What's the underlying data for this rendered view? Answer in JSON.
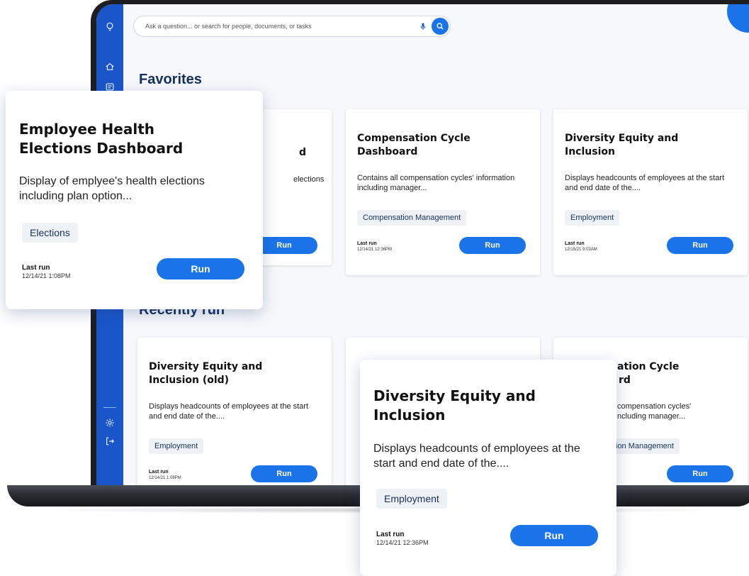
{
  "search": {
    "placeholder": "Ask a question... or search for people, documents, or tasks"
  },
  "sections": {
    "favorites": "Favorites",
    "recently_run": "Recently run"
  },
  "favorites": [
    {
      "title": "Employee Health Elections Dashboard",
      "visible_title_tail": "d",
      "visible_desc_tail": "elections",
      "run_label": "Run"
    },
    {
      "title": "Compensation Cycle Dashboard",
      "description": "Contains all compensation cycles' information including manager...",
      "tag": "Compensation Management",
      "last_run_label": "Last run",
      "last_run_date": "12/14/21 12:36PM",
      "run_label": "Run"
    },
    {
      "title": "Diversity Equity and Inclusion",
      "description": "Displays headcounts of employees at the start and end date of the....",
      "tag": "Employment",
      "last_run_label": "Last run",
      "last_run_date": "12/15/21 9:03AM",
      "run_label": "Run"
    }
  ],
  "recent": [
    {
      "title": "Diversity Equity and Inclusion (old)",
      "description": "Displays headcounts of employees at the start and end date of the....",
      "tag": "Employment",
      "last_run_label": "Last run",
      "last_run_date": "12/14/21 1:08PM",
      "run_label": "Run"
    },
    {
      "visible_title_tail_1": "ation Cycle",
      "visible_title_tail_2": "rd",
      "visible_desc_tail_1": "compensation cycles'",
      "visible_desc_tail_2": "ncluding manager...",
      "visible_tag_tail": "ion Management",
      "run_label": "Run"
    }
  ],
  "popup_health": {
    "title_line1": "Employee Health",
    "title_line2": "Elections Dashboard",
    "description": "Display of emplyee's health elections including plan option...",
    "tag": "Elections",
    "last_run_label": "Last run",
    "last_run_date": "12/14/21 1:08PM",
    "run_label": "Run"
  },
  "popup_diversity": {
    "title_line1": "Diversity Equity and",
    "title_line2": "Inclusion",
    "description": "Displays headcounts of employees at the start and end date of the....",
    "tag": "Employment",
    "last_run_label": "Last run",
    "last_run_date": "12/14/21 12:36PM",
    "run_label": "Run"
  },
  "colors": {
    "accent": "#1a73e8",
    "sidebar": "#1a56c9",
    "heading": "#14315e"
  },
  "icons": [
    "lightbulb-icon",
    "home-icon",
    "calendar-icon",
    "settings-icon",
    "logout-icon",
    "microphone-icon",
    "search-icon"
  ]
}
